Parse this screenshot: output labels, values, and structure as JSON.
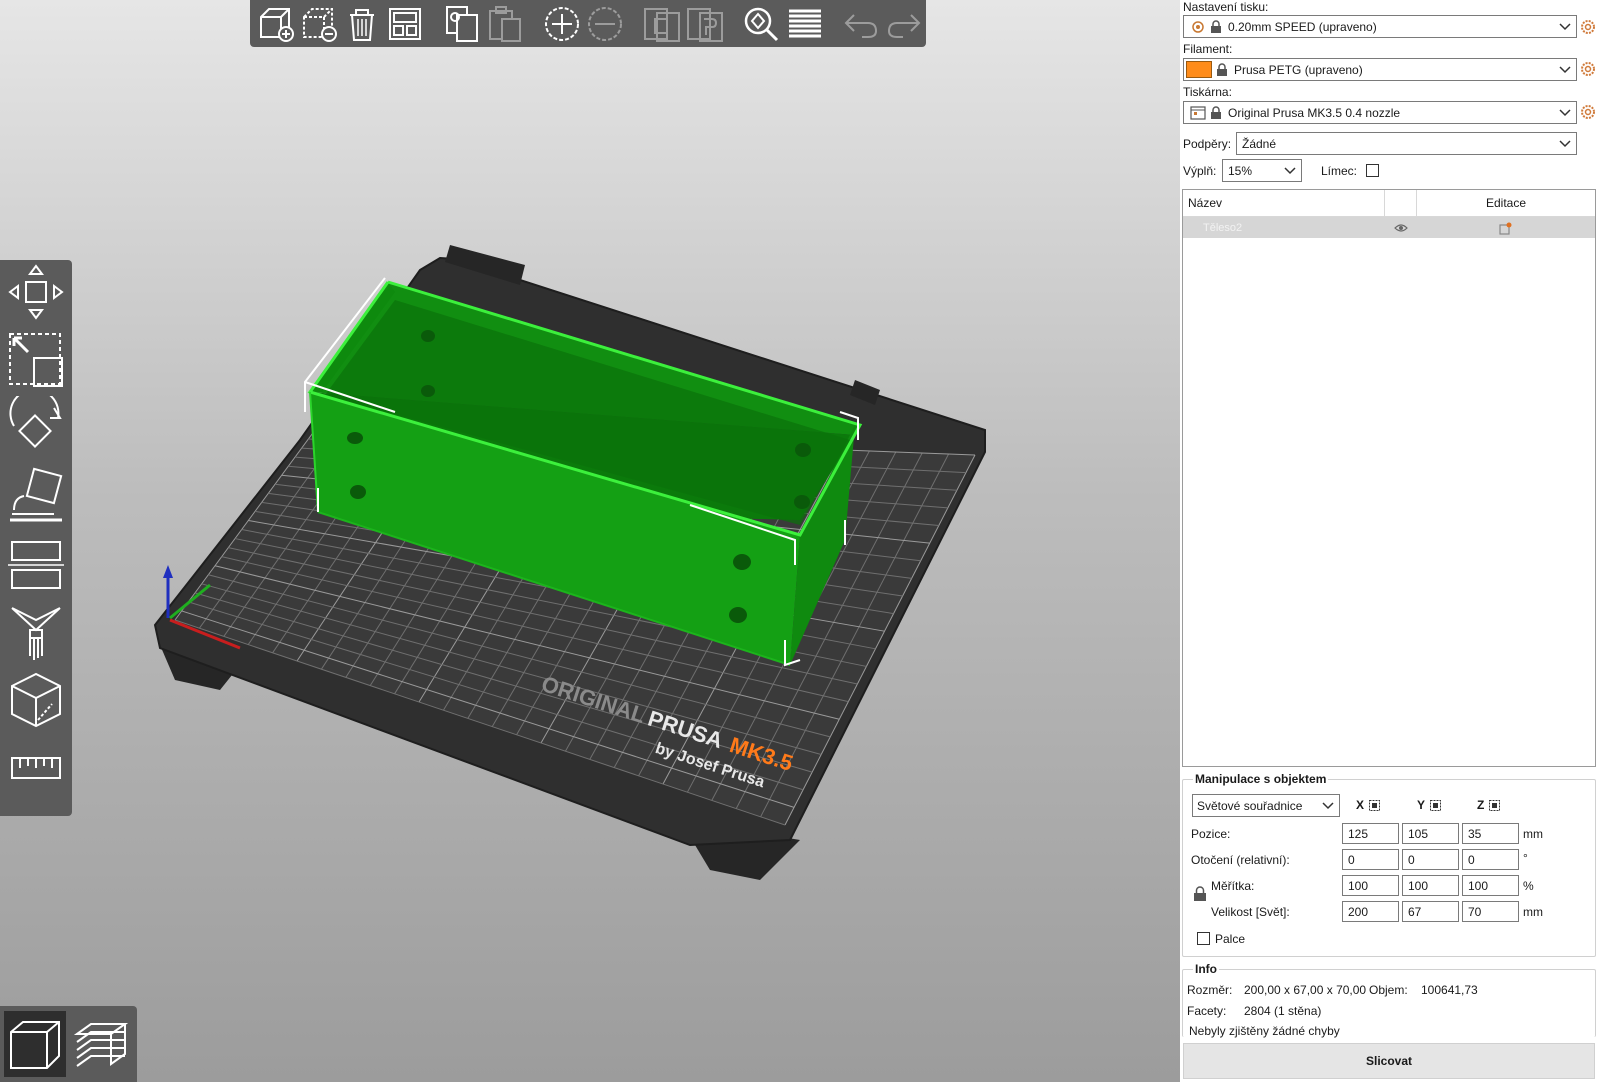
{
  "top_toolbar": {
    "buttons": [
      "add-icon",
      "delete-icon",
      "delete-all-icon",
      "arrange-icon",
      "copy-icon",
      "paste-icon",
      "add-instance-icon",
      "remove-instance-icon",
      "split-objects-icon",
      "split-parts-icon",
      "search-icon",
      "layers-editing-icon",
      "undo-icon",
      "redo-icon"
    ]
  },
  "left_toolbar": {
    "tools": [
      "move-icon",
      "scale-icon",
      "rotate-icon",
      "place-on-face-icon",
      "cut-icon",
      "paint-supports-icon",
      "seam-painting-icon",
      "measure-icon"
    ]
  },
  "view_toggle": [
    "3d-view-icon",
    "preview-icon"
  ],
  "bed": {
    "brand_line1": "ORIGINAL",
    "brand_line2": "PRUSA",
    "model": "MK3.5",
    "byline": "by Josef Prusa"
  },
  "colors": {
    "object": "#14a014",
    "object_dark": "#0f7a0f",
    "object_edge": "#3cf03c",
    "bed": "#2d2d2d",
    "accent_orange": "#ff7a1a",
    "filament": "#ff8c1a"
  },
  "panel": {
    "print_settings_label": "Nastavení tisku:",
    "print_settings_value": "0.20mm SPEED (upraveno)",
    "filament_label": "Filament:",
    "filament_value": "Prusa PETG (upraveno)",
    "printer_label": "Tiskárna:",
    "printer_value": "Original Prusa MK3.5 0.4 nozzle",
    "supports_label": "Podpěry:",
    "supports_value": "Žádné",
    "infill_label": "Výplň:",
    "infill_value": "15%",
    "brim_label": "Límec:",
    "brim_checked": false
  },
  "object_list": {
    "col_name": "Název",
    "col_edit": "Editace",
    "items": [
      {
        "name": "Těleso2"
      }
    ]
  },
  "manipulation": {
    "title": "Manipulace s objektem",
    "coord_system": "Světové souřadnice",
    "axes": [
      "X",
      "Y",
      "Z"
    ],
    "position_label": "Pozice:",
    "position": [
      "125",
      "105",
      "35"
    ],
    "position_unit": "mm",
    "rotation_label": "Otočení (relativní):",
    "rotation": [
      "0",
      "0",
      "0"
    ],
    "rotation_unit": "°",
    "scale_label": "Měřítka:",
    "scale": [
      "100",
      "100",
      "100"
    ],
    "scale_unit": "%",
    "size_label": "Velikost [Svět]:",
    "size": [
      "200",
      "67",
      "70"
    ],
    "size_unit": "mm",
    "inches_label": "Palce",
    "inches_checked": false
  },
  "info": {
    "title": "Info",
    "size_label": "Rozměr:",
    "size_value": "200,00 x 67,00 x 70,00",
    "volume_label": "Objem:",
    "volume_value": "100641,73",
    "facets_label": "Facety:",
    "facets_value": "2804 (1 stěna)",
    "errors": "Nebyly zjištěny žádné chyby"
  },
  "slice_button": "Slicovat"
}
